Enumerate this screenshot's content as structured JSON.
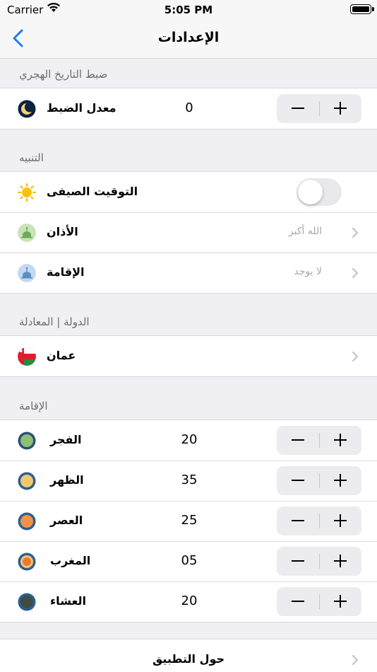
{
  "status_bar": {
    "carrier": "Carrier",
    "time": "5:05 PM"
  },
  "nav": {
    "title": "الإعدادات"
  },
  "hijri": {
    "header": "ضبط التاريخ الهجري",
    "row": {
      "label": "معدل الضبط",
      "value": "0",
      "icon": "moon-icon"
    }
  },
  "alerts": {
    "header": "التنبيه",
    "summer_time": {
      "label": "التوقيت الصيفى",
      "icon": "sun-icon",
      "on": false
    },
    "adhan": {
      "label": "الأذان",
      "detail": "الله أكبر",
      "icon": "mosque-icon",
      "icon_color": "#8fc27a"
    },
    "iqama": {
      "label": "الإقامة",
      "detail": "لا يوجد",
      "icon": "mosque-icon",
      "icon_color": "#8ab4dc"
    }
  },
  "country": {
    "header": "الدولة | المعادلة",
    "row": {
      "label": "عمان",
      "icon": "oman-flag-icon"
    }
  },
  "iqama_section": {
    "header": "الإقامة",
    "prayers": [
      {
        "label": "الفجر",
        "value": "20",
        "color": "#8fbf70"
      },
      {
        "label": "الظهر",
        "value": "35",
        "color": "#f3c86e"
      },
      {
        "label": "العصر",
        "value": "25",
        "color": "#f2924a"
      },
      {
        "label": "المغرب",
        "value": "05",
        "color": "#eb7a2e"
      },
      {
        "label": "العشاء",
        "value": "20",
        "color": "#3d4d44"
      }
    ]
  },
  "about": {
    "label": "حول التطبيق"
  }
}
